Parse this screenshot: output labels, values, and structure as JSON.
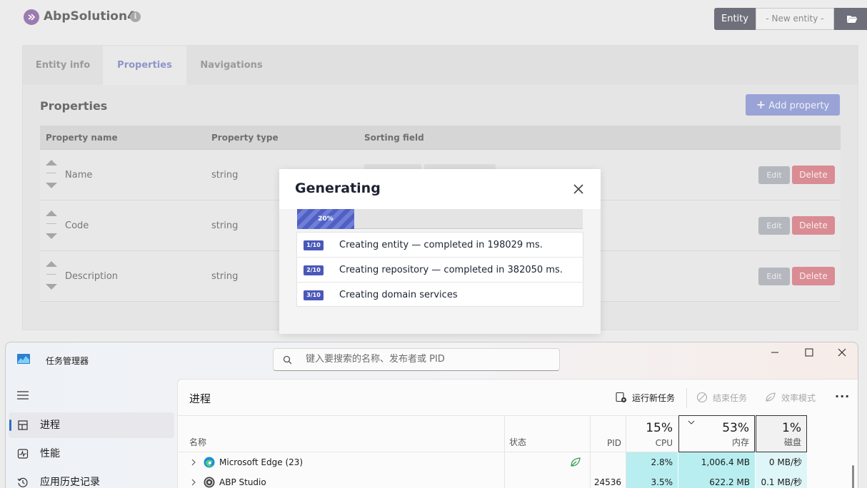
{
  "app": {
    "title": "AbpSolution4",
    "info_icon": "info-icon",
    "entity_label": "Entity",
    "entity_select": "- New entity -",
    "folder_icon": "folder-open-icon"
  },
  "tabs": [
    {
      "label": "Entity info"
    },
    {
      "label": "Properties"
    },
    {
      "label": "Navigations"
    }
  ],
  "properties": {
    "title": "Properties",
    "add_button": "Add property",
    "columns": {
      "name": "Property name",
      "type": "Property type",
      "sorting": "Sorting field"
    },
    "rows": [
      {
        "name": "Name",
        "type": "string"
      },
      {
        "name": "Code",
        "type": "string"
      },
      {
        "name": "Description",
        "type": "string"
      }
    ],
    "edit_label": "Edit",
    "delete_label": "Delete"
  },
  "modal": {
    "title": "Generating",
    "progress_percent": 20,
    "progress_label": "20%",
    "steps": [
      {
        "badge": "1/10",
        "text": "Creating entity — completed in 198029 ms."
      },
      {
        "badge": "2/10",
        "text": "Creating repository — completed in 382050 ms."
      },
      {
        "badge": "3/10",
        "text": "Creating domain services"
      }
    ]
  },
  "taskmgr": {
    "title": "任务管理器",
    "search_placeholder": "键入要搜索的名称、发布者或 PID",
    "nav": [
      {
        "label": "进程",
        "icon": "processes-icon"
      },
      {
        "label": "性能",
        "icon": "performance-icon"
      },
      {
        "label": "应用历史记录",
        "icon": "history-icon"
      }
    ],
    "section": "进程",
    "actions": {
      "run": "运行新任务",
      "end": "结束任务",
      "efficiency": "效率模式"
    },
    "columns": {
      "name": "名称",
      "status": "状态",
      "pid": "PID",
      "cpu_pct": "15%",
      "cpu": "CPU",
      "mem_pct": "53%",
      "mem": "内存",
      "disk_pct": "1%",
      "disk": "磁盘"
    },
    "processes": [
      {
        "name": "Microsoft Edge (23)",
        "pid": "",
        "cpu": "2.8%",
        "mem": "1,006.4 MB",
        "disk": "0 MB/秒",
        "icon": "edge-icon",
        "status_icon": "efficiency-leaf-icon"
      },
      {
        "name": "ABP Studio",
        "pid": "24536",
        "cpu": "3.5%",
        "mem": "622.2 MB",
        "disk": "0.1 MB/秒",
        "icon": "abp-studio-icon",
        "status_icon": ""
      }
    ],
    "colors": {
      "cpu_bg": "#b8eef0",
      "accent": "#2f6fbf"
    }
  }
}
